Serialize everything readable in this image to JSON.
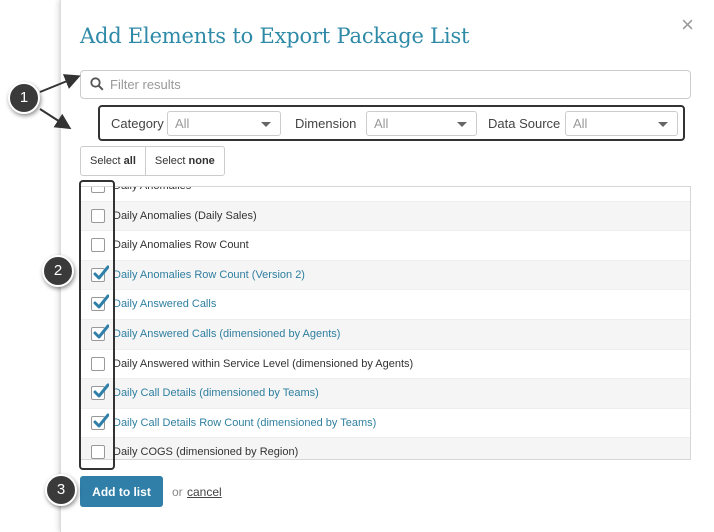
{
  "dialog": {
    "title": "Add Elements to Export Package List",
    "close_symbol": "×"
  },
  "search": {
    "placeholder": "Filter results",
    "value": ""
  },
  "filters": [
    {
      "label": "Category",
      "selected": "All"
    },
    {
      "label": "Dimension",
      "selected": "All"
    },
    {
      "label": "Data Source",
      "selected": "All"
    }
  ],
  "select_buttons": {
    "all_prefix": "Select ",
    "all_bold": "all",
    "none_prefix": "Select ",
    "none_bold": "none"
  },
  "items": [
    {
      "label": "Daily Anomalies",
      "checked": false
    },
    {
      "label": "Daily Anomalies (Daily Sales)",
      "checked": false
    },
    {
      "label": "Daily Anomalies Row Count",
      "checked": false
    },
    {
      "label": "Daily Anomalies Row Count (Version 2)",
      "checked": true
    },
    {
      "label": "Daily Answered Calls",
      "checked": true
    },
    {
      "label": "Daily Answered Calls (dimensioned by Agents)",
      "checked": true
    },
    {
      "label": "Daily Answered within Service Level (dimensioned by Agents)",
      "checked": false
    },
    {
      "label": "Daily Call Details (dimensioned by Teams)",
      "checked": true
    },
    {
      "label": "Daily Call Details Row Count (dimensioned by Teams)",
      "checked": true
    },
    {
      "label": "Daily COGS (dimensioned by Region)",
      "checked": false
    }
  ],
  "footer": {
    "add_label": "Add to list",
    "or_text": "or",
    "cancel_label": "cancel"
  },
  "callouts": {
    "one": "1",
    "two": "2",
    "three": "3"
  },
  "colors": {
    "accent": "#2f8aa8",
    "button": "#2f7fa8",
    "checked_text": "#2f7fa0",
    "callout": "#3a3a3a"
  },
  "icons": {
    "search": "search-icon",
    "close": "close-icon",
    "checkmark": "checkmark-icon",
    "caret": "caret-down-icon"
  }
}
